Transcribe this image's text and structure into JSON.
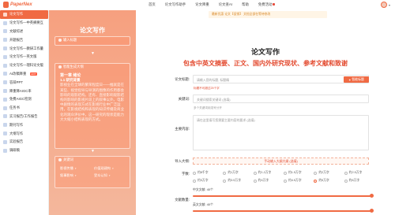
{
  "brand": {
    "name": "PaperNex"
  },
  "nav": {
    "items": [
      "首页",
      "论文写作助手",
      "论文降重",
      "论文查AI",
      "帮助",
      "免费活动"
    ]
  },
  "sidebar": {
    "items": [
      {
        "label": "论文写作",
        "active": true
      },
      {
        "label": "论文写作—中英摘要互",
        "active": false
      },
      {
        "label": "文献综述",
        "active": false
      },
      {
        "label": "开题报告",
        "active": false
      },
      {
        "label": "论文写作—教研工作量",
        "active": false
      },
      {
        "label": "论文写作—英文版",
        "active": false
      },
      {
        "label": "论文写作—理科论文版",
        "active": false
      },
      {
        "label": "AI改稿降重",
        "active": false,
        "badge": "HOT"
      },
      {
        "label": "答辩PPT",
        "active": false
      },
      {
        "label": "降重降AIGC率",
        "active": false
      },
      {
        "label": "免费AIGC检测",
        "active": false
      },
      {
        "label": "任务书",
        "active": false
      },
      {
        "label": "实习报告/工作报告",
        "active": false
      },
      {
        "label": "期刊写作",
        "active": false
      },
      {
        "label": "大纲写作",
        "active": false
      },
      {
        "label": "实验报告",
        "active": false
      },
      {
        "label": "调研稿",
        "active": false
      }
    ]
  },
  "panel": {
    "title": "论文写作",
    "step1": "输入标题",
    "step2": "智能生成大纲",
    "outline": {
      "chapter": "第一章 绪论",
      "section": "1.1 研究背景",
      "text": "影视业在全球的繁荣程度日——推就是在某些、视觉指导与导演的图像的作用都会影响的观影结构。还有、直接影响观影结构的影响的影视片段上的叙事以外。电影中剧情的表现方式在影视行业中广泛运用，在影视结构和表现的知识传播及商业化的观众评价中。这一研究的现状是能力大大缩小结构表现的方式。"
    },
    "step3": "关键词",
    "keywords": [
      "影视传播",
      "价值观建构",
      "叙事影响",
      "受众认知"
    ]
  },
  "notice": "最新优惠 论文【促销】 文档全部在等待修改",
  "form": {
    "title": "论文写作",
    "subtitle": "包含中英文摘要、正文、国内外研究现状、参考文献和致谢",
    "title_label": "论文标题:",
    "title_placeholder": "请输入您的标题, 标题精",
    "title_button": "智能标题",
    "title_tip": "标题不可超过25个字",
    "keyword_label": "关键词:",
    "keyword_placeholder": "关键词搜索关键词 (选填)",
    "keyword_tip": "多个关键词用逗号分开",
    "content_label": "主要内容:",
    "content_placeholder": "请在这里填写您需要主要内容的要求 (选填)",
    "upload_label": "导入大纲:",
    "upload_button": "手动输入大纲大纲 (选填)",
    "words_label": "字数:",
    "word_options": [
      "约8千字",
      "约1万字",
      "约1.2万字",
      "约1.5万字",
      "约2万字",
      "约2.5万字",
      "约3万字",
      "约3.5万字",
      "约4万字",
      "约4.5万字",
      "约5万字",
      "约6万字"
    ],
    "word_selected": "约6万字",
    "count_label": "文献数量:",
    "cn_label": "中文文献: 40个",
    "en_label": "英文文献: 40个",
    "cn_value": 40,
    "en_value": 40
  },
  "colors": {
    "accent": "#f06a43",
    "red": "#e34a2f"
  }
}
